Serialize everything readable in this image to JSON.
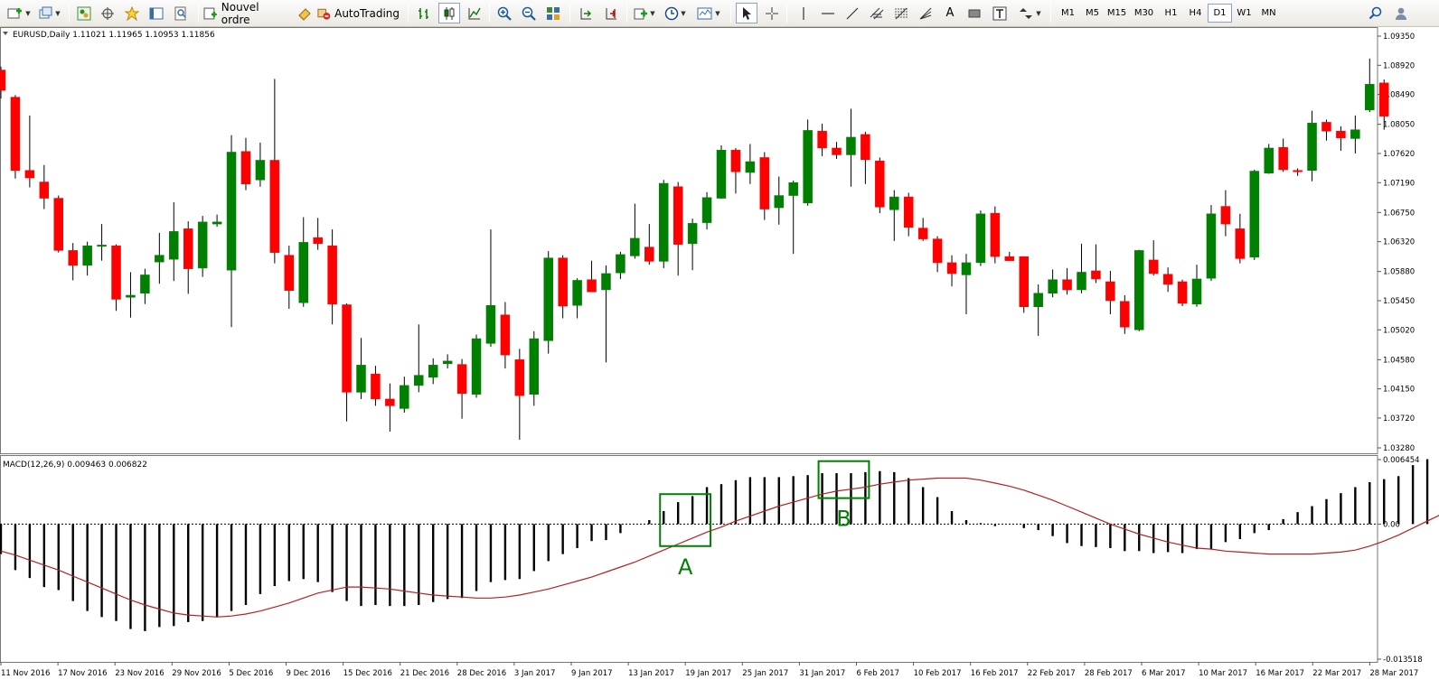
{
  "toolbar": {
    "new_order_label": "Nouvel ordre",
    "autotrading_label": "AutoTrading",
    "text_tool_label": "A",
    "timeframes": [
      "M1",
      "M5",
      "M15",
      "M30",
      "H1",
      "H4",
      "D1",
      "W1",
      "MN"
    ],
    "active_timeframe": "D1"
  },
  "chart_header": {
    "symbol_info": "EURUSD,Daily  1.11021 1.11965 1.10953 1.11856"
  },
  "indicator_header": {
    "label": "MACD(12,26,9) 0.009463 0.006822"
  },
  "colors": {
    "bull": "#008000",
    "bear": "#ff0000",
    "signal": "#b22222",
    "annotation": "#008000",
    "histogram": "#000000"
  },
  "chart_data": [
    {
      "type": "candlestick",
      "title": "EURUSD,Daily",
      "ylim": [
        1.0328,
        1.0935
      ],
      "yticks": [
        "1.09350",
        "1.08920",
        "1.08490",
        "1.08050",
        "1.07620",
        "1.07190",
        "1.06750",
        "1.06320",
        "1.05880",
        "1.05450",
        "1.05020",
        "1.04580",
        "1.04150",
        "1.03720",
        "1.03280"
      ],
      "xticks": [
        "11 Nov 2016",
        "17 Nov 2016",
        "23 Nov 2016",
        "29 Nov 2016",
        "5 Dec 2016",
        "9 Dec 2016",
        "15 Dec 2016",
        "21 Dec 2016",
        "28 Dec 2016",
        "3 Jan 2017",
        "9 Jan 2017",
        "13 Jan 2017",
        "19 Jan 2017",
        "25 Jan 2017",
        "31 Jan 2017",
        "6 Feb 2017",
        "10 Feb 2017",
        "16 Feb 2017",
        "22 Feb 2017",
        "28 Feb 2017",
        "6 Mar 2017",
        "10 Mar 2017",
        "16 Mar 2017",
        "22 Mar 2017",
        "28 Mar 2017"
      ],
      "candles": [
        [
          1.0885,
          1.089,
          1.0843,
          1.0855
        ],
        [
          1.0845,
          1.0848,
          1.0725,
          1.0737
        ],
        [
          1.0737,
          1.0818,
          1.0712,
          1.0726
        ],
        [
          1.072,
          1.0745,
          1.068,
          1.0696
        ],
        [
          1.0696,
          1.07,
          1.0616,
          1.0619
        ],
        [
          1.0619,
          1.063,
          1.0575,
          1.0597
        ],
        [
          1.0597,
          1.0632,
          1.0582,
          1.0626
        ],
        [
          1.0625,
          1.0658,
          1.0604,
          1.0627
        ],
        [
          1.0626,
          1.0628,
          1.053,
          1.0547
        ],
        [
          1.055,
          1.0587,
          1.052,
          1.0553
        ],
        [
          1.0556,
          1.0592,
          1.054,
          1.0583
        ],
        [
          1.0602,
          1.0645,
          1.057,
          1.0612
        ],
        [
          1.0606,
          1.069,
          1.0574,
          1.0647
        ],
        [
          1.0651,
          1.0662,
          1.0555,
          1.0592
        ],
        [
          1.0593,
          1.067,
          1.058,
          1.0661
        ],
        [
          1.0658,
          1.0672,
          1.0654,
          1.0661
        ],
        [
          1.059,
          1.0789,
          1.0506,
          1.0764
        ],
        [
          1.0765,
          1.0785,
          1.0708,
          1.0717
        ],
        [
          1.0723,
          1.0778,
          1.0713,
          1.0752
        ],
        [
          1.0752,
          1.0872,
          1.06,
          1.0616
        ],
        [
          1.0612,
          1.0626,
          1.0533,
          1.056
        ],
        [
          1.0542,
          1.0668,
          1.0536,
          1.0631
        ],
        [
          1.0638,
          1.0667,
          1.062,
          1.0629
        ],
        [
          1.0626,
          1.065,
          1.051,
          1.054
        ],
        [
          1.0539,
          1.0541,
          1.0367,
          1.041
        ],
        [
          1.041,
          1.049,
          1.04,
          1.045
        ],
        [
          1.0437,
          1.0449,
          1.039,
          1.04
        ],
        [
          1.04,
          1.0423,
          1.0352,
          1.039
        ],
        [
          1.0386,
          1.0433,
          1.038,
          1.042
        ],
        [
          1.042,
          1.051,
          1.041,
          1.0435
        ],
        [
          1.0432,
          1.046,
          1.0422,
          1.045
        ],
        [
          1.0452,
          1.0466,
          1.0445,
          1.0456
        ],
        [
          1.0451,
          1.0459,
          1.0371,
          1.0408
        ],
        [
          1.0407,
          1.0495,
          1.0402,
          1.0489
        ],
        [
          1.0482,
          1.065,
          1.0477,
          1.0538
        ],
        [
          1.0524,
          1.0543,
          1.0445,
          1.0465
        ],
        [
          1.0458,
          1.0474,
          1.034,
          1.0405
        ],
        [
          1.0407,
          1.05,
          1.039,
          1.0489
        ],
        [
          1.0486,
          1.0618,
          1.0467,
          1.0608
        ],
        [
          1.0608,
          1.0612,
          1.0519,
          1.0537
        ],
        [
          1.0538,
          1.0578,
          1.0519,
          1.0575
        ],
        [
          1.0576,
          1.0604,
          1.0566,
          1.0558
        ],
        [
          1.0561,
          1.0597,
          1.0454,
          1.0585
        ],
        [
          1.0586,
          1.0617,
          1.0577,
          1.0613
        ],
        [
          1.0611,
          1.0688,
          1.0607,
          1.0637
        ],
        [
          1.0624,
          1.0658,
          1.0598,
          1.0603
        ],
        [
          1.0603,
          1.0723,
          1.0593,
          1.0718
        ],
        [
          1.0713,
          1.072,
          1.0582,
          1.0628
        ],
        [
          1.0629,
          1.0666,
          1.059,
          1.0659
        ],
        [
          1.066,
          1.0705,
          1.065,
          1.0697
        ],
        [
          1.0696,
          1.0774,
          1.0695,
          1.0767
        ],
        [
          1.0767,
          1.077,
          1.0703,
          1.0735
        ],
        [
          1.0734,
          1.0776,
          1.0717,
          1.075
        ],
        [
          1.0756,
          1.0764,
          1.0664,
          1.068
        ],
        [
          1.0682,
          1.0728,
          1.0657,
          1.07
        ],
        [
          1.07,
          1.0722,
          1.0614,
          1.0719
        ],
        [
          1.0689,
          1.0812,
          1.0685,
          1.0796
        ],
        [
          1.0795,
          1.0806,
          1.0758,
          1.077
        ],
        [
          1.077,
          1.0779,
          1.0754,
          1.076
        ],
        [
          1.076,
          1.0828,
          1.0713,
          1.0786
        ],
        [
          1.079,
          1.0794,
          1.0717,
          1.0753
        ],
        [
          1.0751,
          1.0756,
          1.0674,
          1.0683
        ],
        [
          1.0679,
          1.0708,
          1.0633,
          1.0698
        ],
        [
          1.0698,
          1.0704,
          1.064,
          1.0653
        ],
        [
          1.0652,
          1.0667,
          1.0633,
          1.0636
        ],
        [
          1.0636,
          1.064,
          1.0587,
          1.0601
        ],
        [
          1.0601,
          1.0612,
          1.0566,
          1.0585
        ],
        [
          1.0583,
          1.0614,
          1.0525,
          1.0601
        ],
        [
          1.0601,
          1.0678,
          1.0596,
          1.0673
        ],
        [
          1.0674,
          1.0684,
          1.06,
          1.061
        ],
        [
          1.061,
          1.0617,
          1.0605,
          1.0604
        ],
        [
          1.061,
          1.061,
          1.0527,
          1.0536
        ],
        [
          1.0536,
          1.0569,
          1.0493,
          1.0556
        ],
        [
          1.0556,
          1.0591,
          1.055,
          1.0576
        ],
        [
          1.0576,
          1.0593,
          1.0554,
          1.0561
        ],
        [
          1.0561,
          1.0629,
          1.0556,
          1.0587
        ],
        [
          1.0589,
          1.0628,
          1.0571,
          1.0577
        ],
        [
          1.0573,
          1.0589,
          1.0525,
          1.0545
        ],
        [
          1.0544,
          1.0553,
          1.0496,
          1.0506
        ],
        [
          1.0502,
          1.062,
          1.05,
          1.0619
        ],
        [
          1.0605,
          1.0634,
          1.0582,
          1.0585
        ],
        [
          1.0584,
          1.0594,
          1.0558,
          1.0569
        ],
        [
          1.0573,
          1.0576,
          1.0537,
          1.0541
        ],
        [
          1.054,
          1.0598,
          1.0536,
          1.0577
        ],
        [
          1.0578,
          1.0686,
          1.0574,
          1.0673
        ],
        [
          1.0684,
          1.0708,
          1.064,
          1.0658
        ],
        [
          1.0651,
          1.0673,
          1.06,
          1.0607
        ],
        [
          1.0609,
          1.0738,
          1.0605,
          1.0736
        ],
        [
          1.0733,
          1.0776,
          1.0732,
          1.077
        ],
        [
          1.0771,
          1.0784,
          1.0735,
          1.0738
        ],
        [
          1.0737,
          1.074,
          1.0729,
          1.0736
        ],
        [
          1.0737,
          1.0825,
          1.0721,
          1.0807
        ],
        [
          1.0808,
          1.0812,
          1.0781,
          1.0795
        ],
        [
          1.0795,
          1.0802,
          1.0766,
          1.0785
        ],
        [
          1.0784,
          1.0818,
          1.0762,
          1.0797
        ],
        [
          1.0826,
          1.0902,
          1.0823,
          1.0864
        ],
        [
          1.0866,
          1.0871,
          1.0797,
          1.0817
        ]
      ]
    },
    {
      "type": "bar",
      "title": "MACD(12,26,9)",
      "ylim": [
        -0.013518,
        0.006454
      ],
      "yticks": [
        "0.006454",
        "0.00",
        "-0.013518"
      ],
      "histogram": [
        -0.003,
        -0.0046,
        -0.0054,
        -0.0063,
        -0.0066,
        -0.0077,
        -0.0087,
        -0.0093,
        -0.0097,
        -0.0105,
        -0.0107,
        -0.0103,
        -0.0102,
        -0.0098,
        -0.0097,
        -0.0093,
        -0.0087,
        -0.0081,
        -0.007,
        -0.0062,
        -0.0057,
        -0.0055,
        -0.0058,
        -0.0068,
        -0.0077,
        -0.0082,
        -0.0081,
        -0.0082,
        -0.0082,
        -0.0081,
        -0.0078,
        -0.0075,
        -0.0074,
        -0.0067,
        -0.0058,
        -0.0056,
        -0.0055,
        -0.0047,
        -0.0037,
        -0.003,
        -0.0024,
        -0.0017,
        -0.0016,
        -0.0009,
        0.0,
        0.0004,
        0.0013,
        0.0022,
        0.0028,
        0.0037,
        0.004,
        0.0044,
        0.0047,
        0.0047,
        0.0047,
        0.0048,
        0.0049,
        0.0051,
        0.0051,
        0.0051,
        0.0052,
        0.0053,
        0.0052,
        0.0046,
        0.0037,
        0.0027,
        0.0013,
        0.0004,
        0.0001,
        -0.0002,
        0.0,
        -0.0004,
        -0.0006,
        -0.0012,
        -0.0019,
        -0.0022,
        -0.0023,
        -0.0024,
        -0.0027,
        -0.0027,
        -0.0029,
        -0.0028,
        -0.0029,
        -0.0025,
        -0.0025,
        -0.0018,
        -0.0015,
        -0.0009,
        -0.0006,
        0.0005,
        0.0012,
        0.0018,
        0.0025,
        0.0031,
        0.0037,
        0.0042,
        0.0045,
        0.0048,
        0.0059,
        0.0065
      ],
      "signal": [
        -0.0027,
        -0.0031,
        -0.0036,
        -0.0041,
        -0.0046,
        -0.0052,
        -0.0058,
        -0.0064,
        -0.007,
        -0.0076,
        -0.0081,
        -0.0085,
        -0.0089,
        -0.0091,
        -0.0092,
        -0.0093,
        -0.0092,
        -0.009,
        -0.0087,
        -0.0083,
        -0.0079,
        -0.0074,
        -0.0069,
        -0.0066,
        -0.0063,
        -0.0063,
        -0.0064,
        -0.0065,
        -0.0067,
        -0.0069,
        -0.0071,
        -0.0072,
        -0.0073,
        -0.0074,
        -0.0074,
        -0.0073,
        -0.0071,
        -0.0068,
        -0.0065,
        -0.0061,
        -0.0057,
        -0.0053,
        -0.0048,
        -0.0043,
        -0.0038,
        -0.0032,
        -0.0026,
        -0.002,
        -0.0014,
        -0.0008,
        -0.0003,
        0.0003,
        0.0008,
        0.0013,
        0.0018,
        0.0022,
        0.0026,
        0.003,
        0.0033,
        0.0035,
        0.0037,
        0.004,
        0.0042,
        0.0044,
        0.0045,
        0.0046,
        0.0046,
        0.0046,
        0.0044,
        0.0041,
        0.0038,
        0.0034,
        0.0029,
        0.0024,
        0.0018,
        0.0012,
        0.0006,
        0.0,
        -0.0005,
        -0.001,
        -0.0014,
        -0.0018,
        -0.0021,
        -0.0024,
        -0.0025,
        -0.0027,
        -0.0028,
        -0.0029,
        -0.003,
        -0.003,
        -0.003,
        -0.003,
        -0.0029,
        -0.0028,
        -0.0026,
        -0.0022,
        -0.0017,
        -0.0011,
        -0.0004,
        0.0003,
        0.001,
        0.0016,
        0.0021,
        0.0027,
        0.0033,
        0.004
      ]
    }
  ],
  "annotations": [
    {
      "label": "A",
      "bar_start": 46,
      "bar_end": 49,
      "value_top": 0.003,
      "value_bottom": -0.0022
    },
    {
      "label": "B",
      "bar_start": 57,
      "bar_end": 60,
      "value_top": 0.0063,
      "value_bottom": 0.0026
    }
  ]
}
